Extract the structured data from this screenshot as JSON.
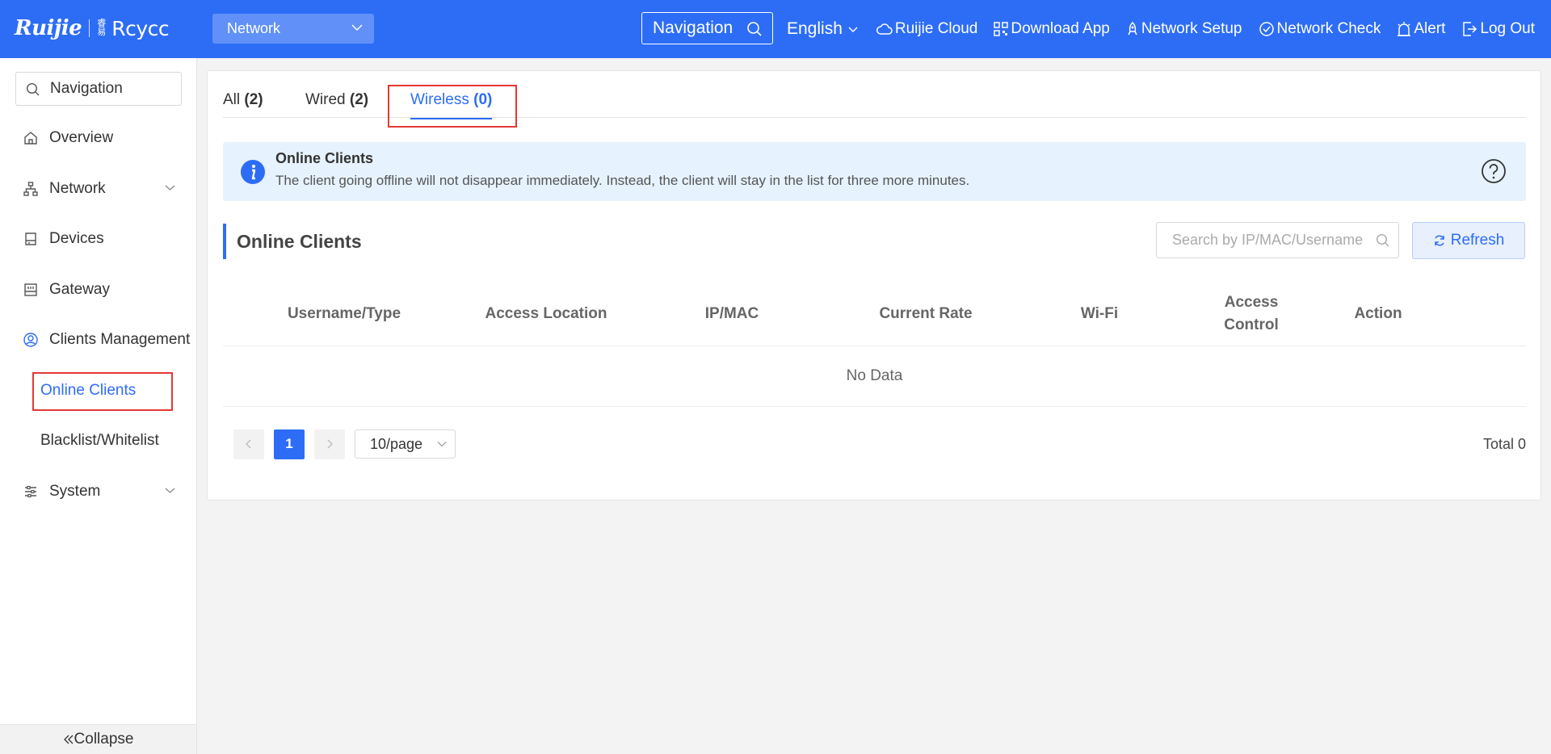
{
  "header": {
    "logo_text": "Ruijie",
    "logo_sub_cn": "睿易",
    "logo_sub": "Rcycc",
    "network_select": "Network",
    "nav_search": "Navigation",
    "language": "English",
    "links": [
      {
        "label": "Ruijie Cloud",
        "icon": "cloud-icon"
      },
      {
        "label": "Download App",
        "icon": "qrcode-icon"
      },
      {
        "label": "Network Setup",
        "icon": "rocket-icon"
      },
      {
        "label": "Network Check",
        "icon": "check-icon"
      },
      {
        "label": "Alert",
        "icon": "alert-icon"
      },
      {
        "label": "Log Out",
        "icon": "logout-icon"
      }
    ]
  },
  "sidebar": {
    "search_label": "Navigation",
    "items": [
      {
        "label": "Overview",
        "icon": "home-icon"
      },
      {
        "label": "Network",
        "icon": "network-icon"
      },
      {
        "label": "Devices",
        "icon": "devices-icon"
      },
      {
        "label": "Gateway",
        "icon": "gateway-icon"
      },
      {
        "label": "Clients Management",
        "icon": "user-icon"
      },
      {
        "label": "System",
        "icon": "system-icon"
      }
    ],
    "sub_items": [
      "Online Clients",
      "Blacklist/Whitelist"
    ],
    "collapse": "Collapse"
  },
  "tabs": [
    {
      "label": "All",
      "count": "(2)"
    },
    {
      "label": "Wired",
      "count": "(2)"
    },
    {
      "label": "Wireless",
      "count": "(0)"
    }
  ],
  "info": {
    "title": "Online Clients",
    "description": "The client going offline will not disappear immediately. Instead, the client will stay in the list for three more minutes."
  },
  "section": {
    "title": "Online Clients",
    "search_placeholder": "Search by IP/MAC/Username",
    "refresh": "Refresh"
  },
  "table": {
    "columns": [
      "Username/Type",
      "Access Location",
      "IP/MAC",
      "Current Rate",
      "Wi-Fi",
      "Access Control",
      "Action"
    ],
    "empty": "No Data"
  },
  "pagination": {
    "current_page": "1",
    "page_size": "10/page",
    "total": "Total 0"
  },
  "colors": {
    "primary": "#2d6df6",
    "highlight_box": "#e53935"
  }
}
